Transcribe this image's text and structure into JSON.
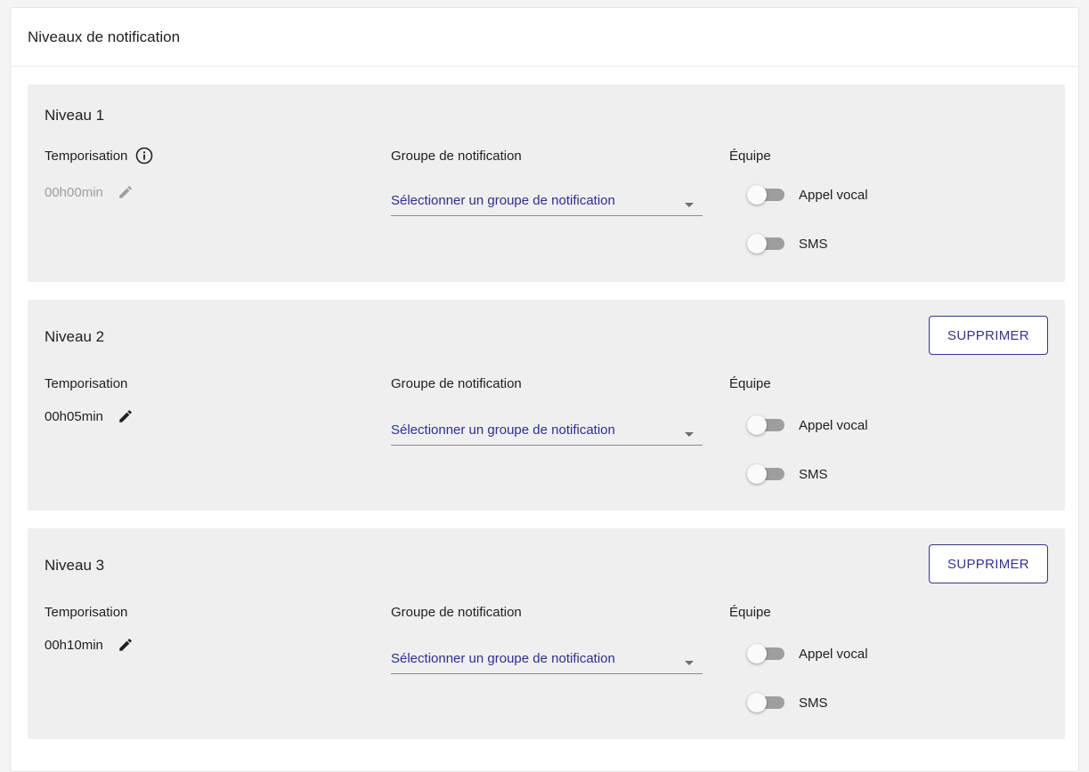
{
  "panel": {
    "title": "Niveaux de notification"
  },
  "levels": [
    {
      "title": "Niveau 1",
      "delay_label": "Temporisation",
      "delay_value": "00h00min",
      "group_label": "Groupe de notification",
      "group_placeholder": "Sélectionner un groupe de notification",
      "team_label": "Équipe",
      "voice_label": "Appel vocal",
      "sms_label": "SMS",
      "voice_enabled": false,
      "sms_enabled": false
    },
    {
      "title": "Niveau 2",
      "delay_label": "Temporisation",
      "delay_value": "00h05min",
      "group_label": "Groupe de notification",
      "group_placeholder": "Sélectionner un groupe de notification",
      "team_label": "Équipe",
      "voice_label": "Appel vocal",
      "sms_label": "SMS",
      "delete_label": "SUPPRIMER",
      "voice_enabled": false,
      "sms_enabled": false
    },
    {
      "title": "Niveau 3",
      "delay_label": "Temporisation",
      "delay_value": "00h10min",
      "group_label": "Groupe de notification",
      "group_placeholder": "Sélectionner un groupe de notification",
      "team_label": "Équipe",
      "voice_label": "Appel vocal",
      "sms_label": "SMS",
      "delete_label": "SUPPRIMER",
      "voice_enabled": false,
      "sms_enabled": false
    }
  ],
  "icons": {
    "info": "info-circle-icon",
    "edit": "pencil-icon",
    "dropdown": "caret-down-icon"
  },
  "colors": {
    "accent": "#35358a",
    "select_text": "#2f2f8f",
    "card_background": "#efefef",
    "disabled_text": "#9e9e9e"
  }
}
